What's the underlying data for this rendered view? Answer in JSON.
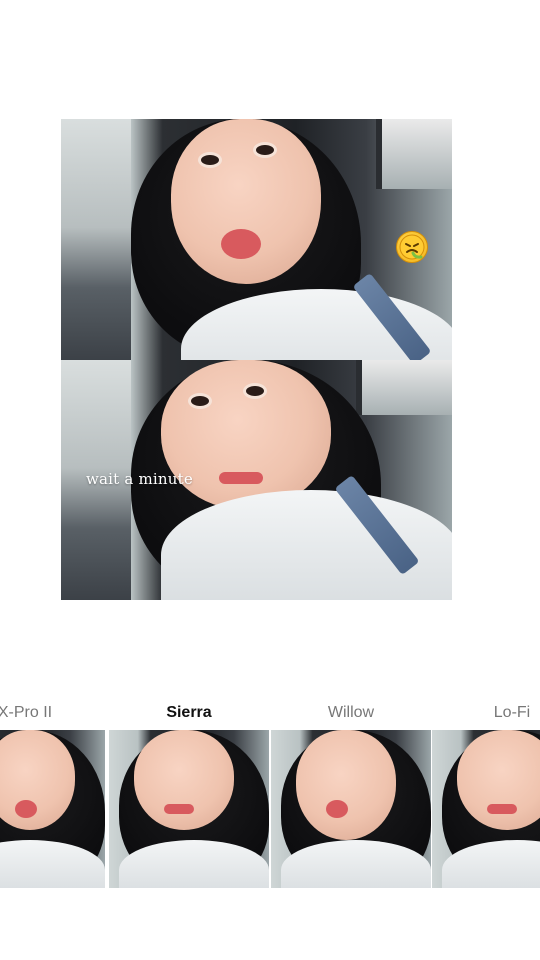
{
  "preview": {
    "overlay_caption": "wait a minute",
    "sticker_icon": "sick-emoji-icon"
  },
  "filters": {
    "items": [
      {
        "label": "X-Pro II",
        "active": false
      },
      {
        "label": "Sierra",
        "active": true
      },
      {
        "label": "Willow",
        "active": false
      },
      {
        "label": "Lo-Fi",
        "active": false
      }
    ]
  }
}
